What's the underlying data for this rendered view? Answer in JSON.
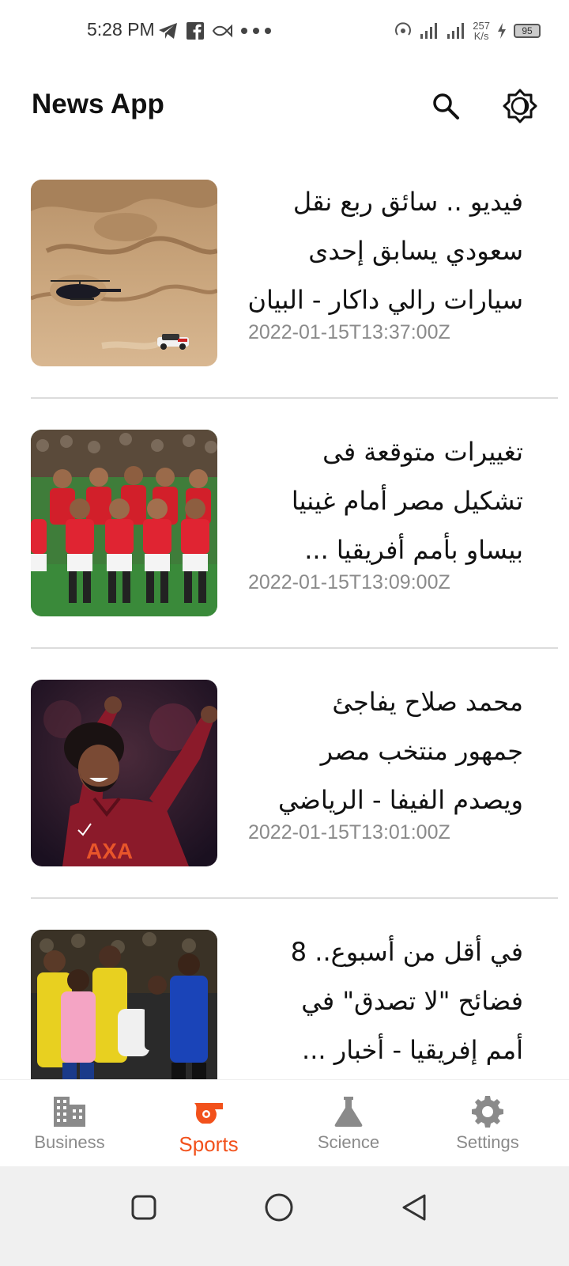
{
  "status_bar": {
    "time": "5:28 PM",
    "left_icons": [
      "telegram-icon",
      "facebook-icon",
      "fish-icon",
      "more-dots-icon"
    ],
    "speed": "257\nK/s",
    "battery": "95"
  },
  "app_bar": {
    "title": "News App",
    "search_icon": "search-icon",
    "theme_icon": "brightness-icon"
  },
  "articles": [
    {
      "headline": "فيديو .. سائق ربع نقل\nسعودي يسابق إحدى\nسيارات رالي داكار - البيان",
      "timestamp": "2022-01-15T13:37:00Z",
      "image": "desert-helicopter-photo"
    },
    {
      "headline": "تغييرات متوقعة فى\nتشكيل مصر أمام غينيا\nبيساو بأمم أفريقيا ...",
      "timestamp": "2022-01-15T13:09:00Z",
      "image": "egypt-team-photo"
    },
    {
      "headline": "محمد صلاح يفاجئ\nجمهور منتخب مصر\nويصدم الفيفا - الرياضي",
      "timestamp": "2022-01-15T13:01:00Z",
      "image": "player-celebration-photo"
    },
    {
      "headline": "في أقل من أسبوع.. 8\nفضائح \"لا تصدق\" في\nأمم إفريقيا - أخبار ...",
      "timestamp": "",
      "image": "match-scuffle-photo"
    }
  ],
  "bottom_nav": {
    "items": [
      {
        "label": "Business",
        "icon": "building-icon",
        "active": false
      },
      {
        "label": "Sports",
        "icon": "whistle-icon",
        "active": true
      },
      {
        "label": "Science",
        "icon": "flask-icon",
        "active": false
      },
      {
        "label": "Settings",
        "icon": "gear-icon",
        "active": false
      }
    ]
  },
  "colors": {
    "accent": "#f2511b",
    "inactive": "#8a8a8a",
    "divider": "#dcdcdc"
  }
}
